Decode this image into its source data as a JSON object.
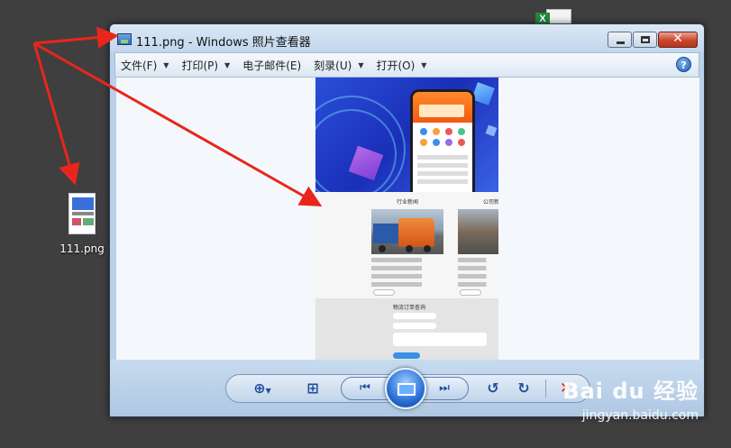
{
  "window": {
    "title": "111.png - Windows 照片查看器",
    "minimize_icon": "minimize-icon",
    "maximize_icon": "maximize-icon",
    "close_icon": "close-icon"
  },
  "menu": {
    "items": [
      {
        "label": "文件(F)",
        "has_dropdown": true
      },
      {
        "label": "打印(P)",
        "has_dropdown": true
      },
      {
        "label": "电子邮件(E)",
        "has_dropdown": false
      },
      {
        "label": "刻录(U)",
        "has_dropdown": true
      },
      {
        "label": "打开(O)",
        "has_dropdown": true
      }
    ],
    "help_icon": "help-icon",
    "help_glyph": "?"
  },
  "photo": {
    "news_title": "行业新闻",
    "company_title": "公司新闻",
    "form_title": "物流订单查询"
  },
  "controls": {
    "zoom_icon": "zoom-icon",
    "fit_icon": "actual-size-icon",
    "prev_icon": "previous-icon",
    "slideshow_icon": "slideshow-icon",
    "next_icon": "next-icon",
    "rotate_ccw_icon": "rotate-left-icon",
    "rotate_cw_icon": "rotate-right-icon",
    "delete_icon": "delete-icon"
  },
  "desktop": {
    "file_label": "111.png",
    "excel_icon": "excel-file-icon"
  },
  "watermark": {
    "logo": "Bai du 经验",
    "url": "jingyan.baidu.com"
  },
  "colors": {
    "arrow": "#e8261c",
    "window_frame": "#b9d1ea",
    "desktop": "#3f3f3f"
  }
}
